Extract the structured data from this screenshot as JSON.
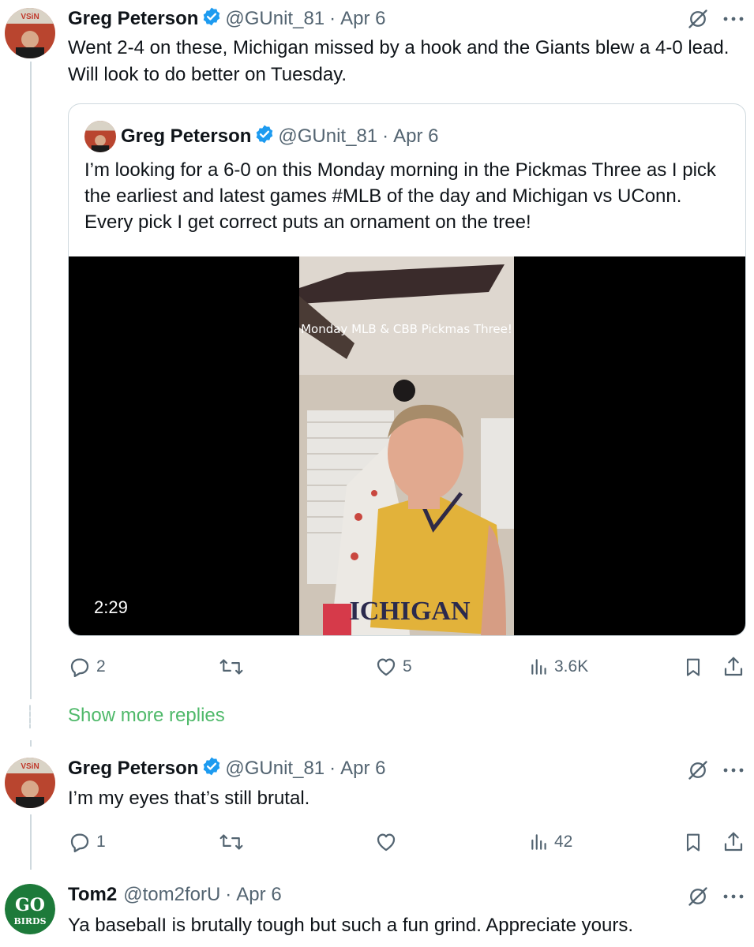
{
  "tweets": [
    {
      "name": "Greg Peterson",
      "handle": "@GUnit_81",
      "date": "Apr 6",
      "text": "Went 2-4 on these, Michigan missed by a hook and the Giants blew a 4-0 lead. Will look to do better on Tuesday.",
      "avatar_badge": "VSiN"
    },
    {
      "name": "Greg Peterson",
      "handle": "@GUnit_81",
      "date": "Apr 6",
      "text": "I’m my eyes that’s still brutal.",
      "avatar_badge": "VSiN",
      "stats": {
        "replies": "1",
        "likes": "",
        "views": "42"
      }
    },
    {
      "name": "Tom2",
      "handle": "@tom2forU",
      "date": "Apr 6",
      "text": "Ya basebalI is brutally tough but such a fun grind. Appreciate yours.",
      "avatar_text_1": "GO",
      "avatar_text_2": "BIRDS"
    }
  ],
  "quote": {
    "name": "Greg Peterson",
    "handle": "@GUnit_81",
    "date": "Apr 6",
    "text": "I’m looking for a 6-0 on this Monday morning in the Pickmas Three as I pick the earliest and latest games #MLB of the day and Michigan vs UConn. Every pick I get correct puts an ornament on the tree!",
    "video_overlay": "Monday MLB & CBB Pickmas Three!",
    "video_duration": "2:29",
    "jersey_text": "ICHIGAN"
  },
  "first_stats": {
    "replies": "2",
    "likes": "5",
    "views": "3.6K"
  },
  "show_more": "Show more replies",
  "separator": "·",
  "colors": {
    "verified": "#1d9bf0",
    "link_green": "#4fb96a",
    "muted": "#536471",
    "avatar_green": "#1d7a3a"
  },
  "icons": [
    "reply-icon",
    "retweet-icon",
    "like-icon",
    "views-icon",
    "bookmark-icon",
    "share-icon",
    "grok-icon",
    "more-icon",
    "verified-icon"
  ]
}
